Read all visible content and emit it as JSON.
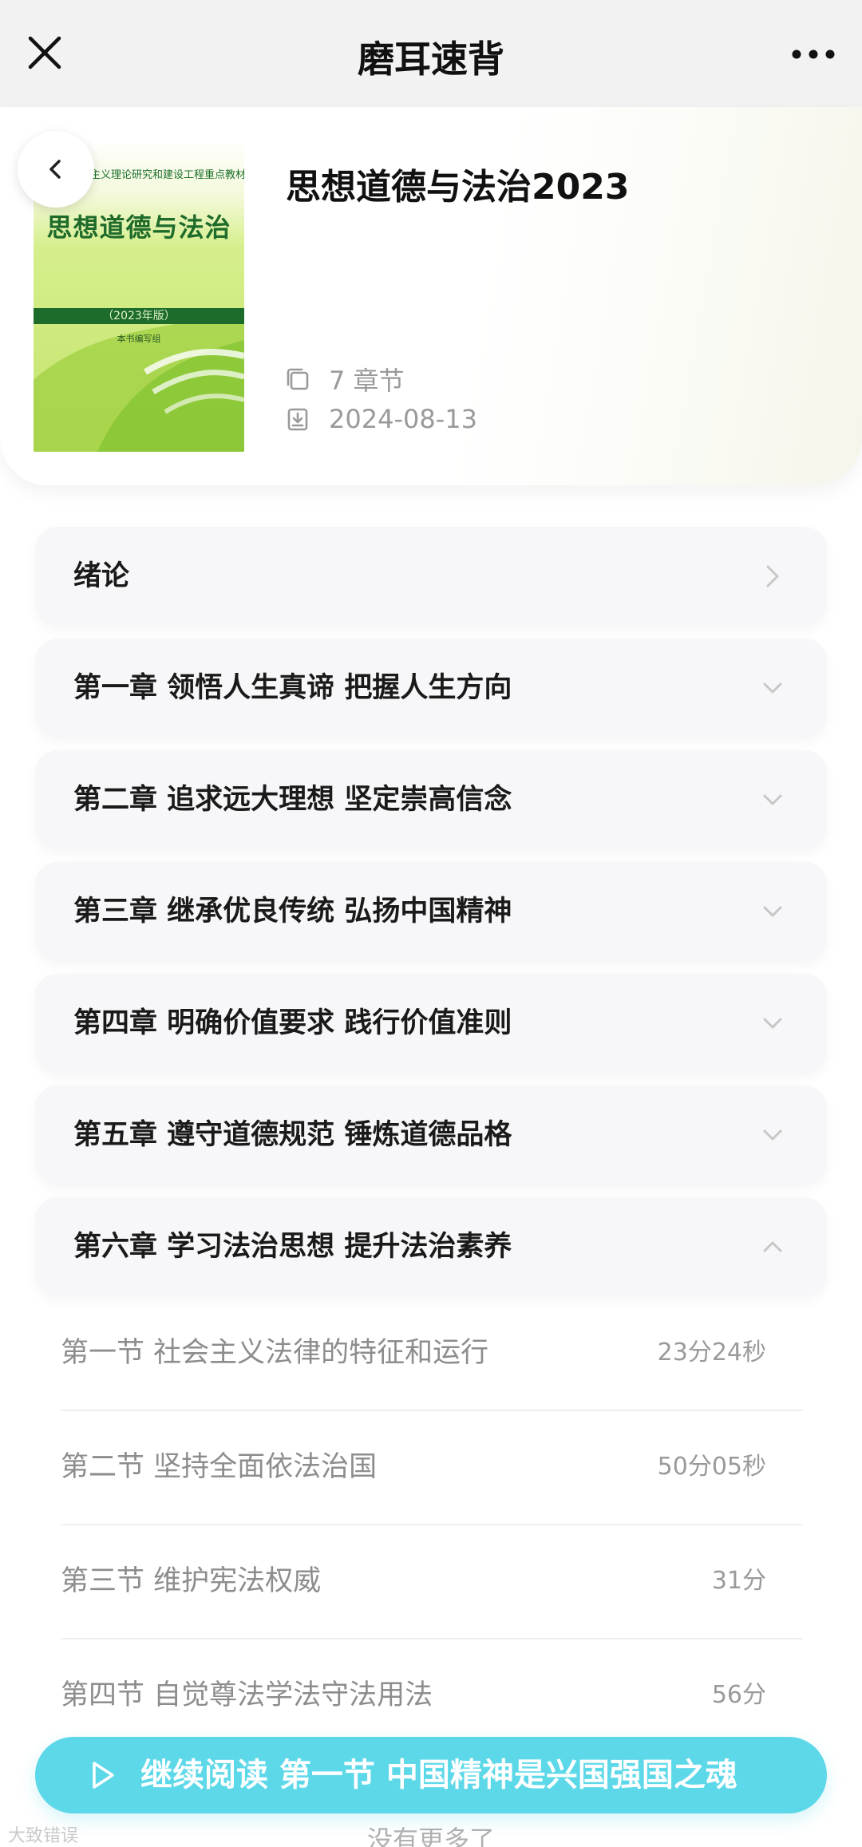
{
  "topbar": {
    "title": "磨耳速背",
    "close_icon": "close-icon",
    "more_icon": "more-dots-icon"
  },
  "book": {
    "title": "思想道德与法治2023",
    "chapter_count": "7 章节",
    "date": "2024-08-13",
    "cover": {
      "publisher": "马克思主义理论研究和建设工程重点教材",
      "title": "思想道德与法治",
      "edition": "（2023年版）",
      "author": "本书编写组"
    }
  },
  "chapters": [
    {
      "label": "绪论",
      "chevron": "right"
    },
    {
      "label": "第一章 领悟人生真谛 把握人生方向",
      "chevron": "down"
    },
    {
      "label": "第二章 追求远大理想 坚定崇高信念",
      "chevron": "down"
    },
    {
      "label": "第三章 继承优良传统 弘扬中国精神",
      "chevron": "down"
    },
    {
      "label": "第四章 明确价值要求 践行价值准则",
      "chevron": "down"
    },
    {
      "label": "第五章 遵守道德规范 锤炼道德品格",
      "chevron": "down"
    },
    {
      "label": "第六章 学习法治思想 提升法治素养",
      "chevron": "up"
    }
  ],
  "sections": [
    {
      "label": "第一节 社会主义法律的特征和运行",
      "duration": "23分24秒"
    },
    {
      "label": "第二节 坚持全面依法治国",
      "duration": "50分05秒"
    },
    {
      "label": "第三节 维护宪法权威",
      "duration": "31分"
    },
    {
      "label": "第四节 自觉尊法学法守法用法",
      "duration": "56分"
    }
  ],
  "continue": {
    "label": "继续阅读 第一节 中国精神是兴国强国之魂",
    "icon": "play-icon"
  },
  "footer": {
    "text": "没有更多了"
  },
  "watermark": "大致错误",
  "colors": {
    "accent": "#5cd8e8",
    "cover_green": "#1d6c2b"
  }
}
